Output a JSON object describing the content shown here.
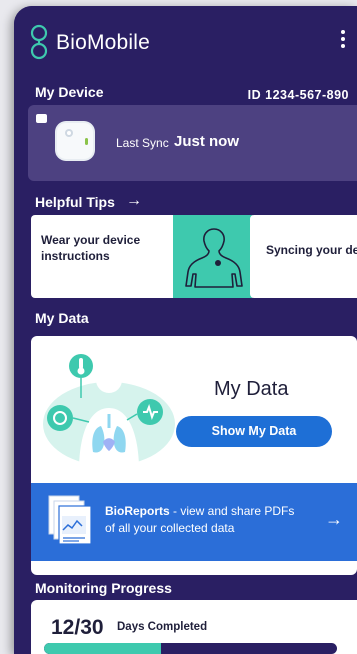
{
  "header": {
    "app_title": "BioMobile"
  },
  "device": {
    "section_title": "My Device",
    "id_text": "ID 1234-567-890",
    "sync_label": "Last Sync",
    "sync_value": "Just now"
  },
  "tips": {
    "section_title": "Helpful Tips",
    "arrow": "→",
    "cards": [
      {
        "text": "Wear your device instructions"
      },
      {
        "text": "Syncing your device daily"
      }
    ]
  },
  "my_data": {
    "section_title": "My Data",
    "card_title": "My Data",
    "button_label": "Show My Data",
    "reports_bold": "BioReports",
    "reports_rest": " - view and share PDFs of all your collected data",
    "reports_arrow": "→"
  },
  "monitoring": {
    "section_title": "Monitoring Progress",
    "count": "12/30",
    "label": "Days Completed",
    "progress_fraction": 0.4
  },
  "colors": {
    "background": "#2a1f63",
    "card_device": "#4d4181",
    "accent_teal": "#3ec9ae",
    "accent_blue": "#1e6fd6"
  }
}
